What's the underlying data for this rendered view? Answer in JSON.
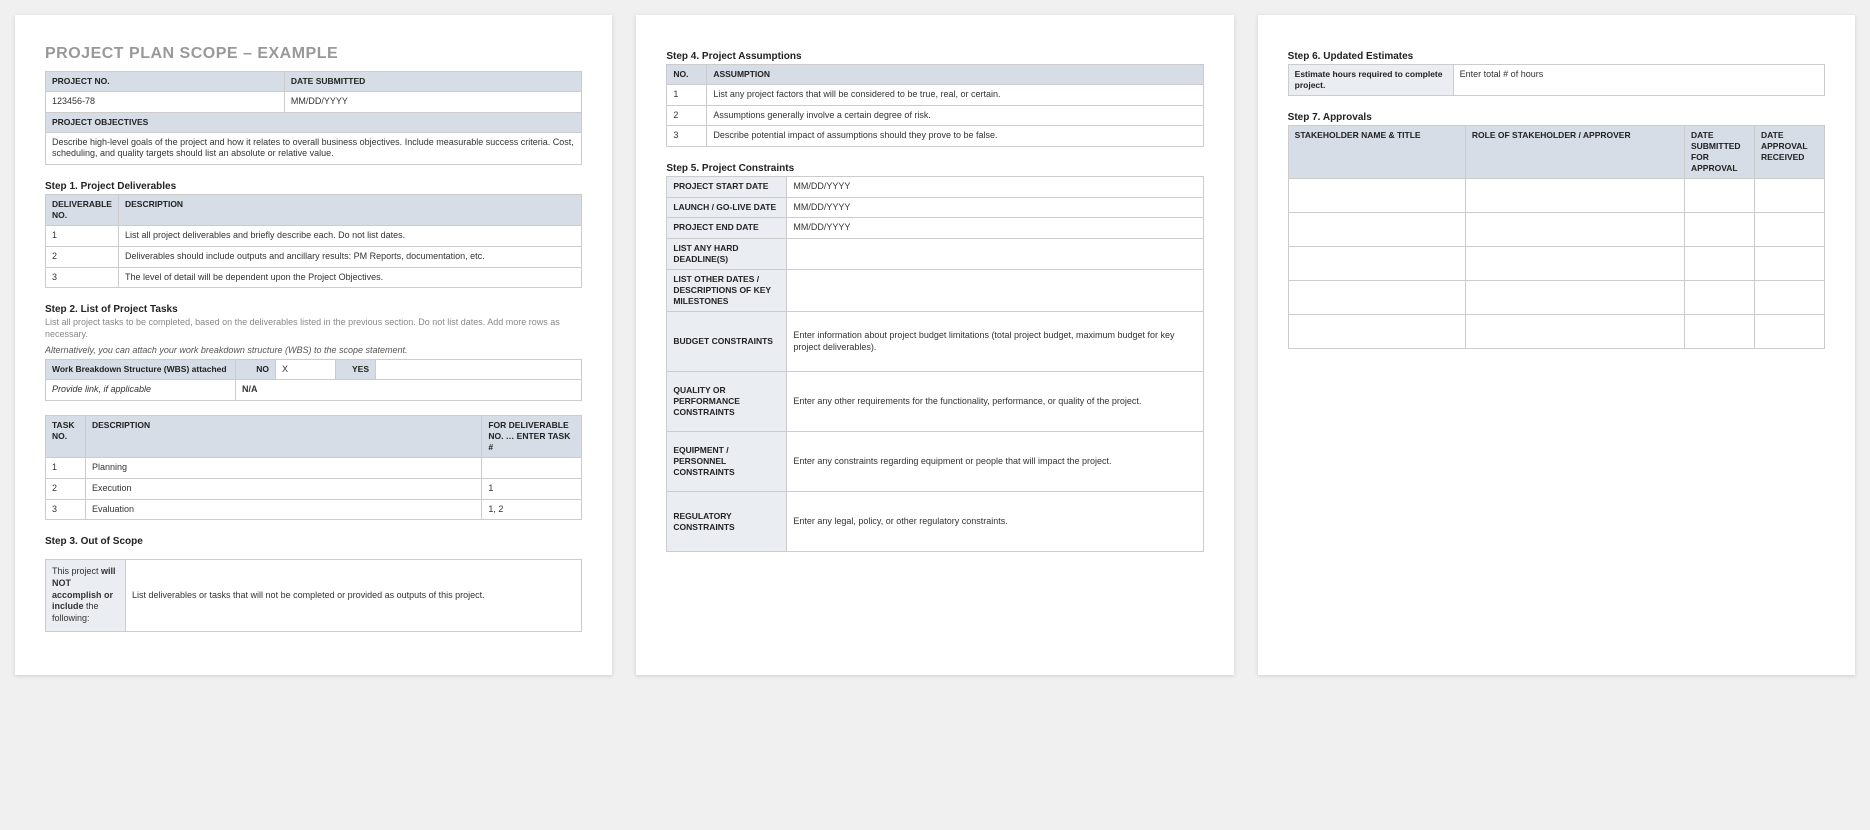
{
  "title": "PROJECT PLAN SCOPE – EXAMPLE",
  "header": {
    "proj_no_label": "PROJECT NO.",
    "proj_no": "123456-78",
    "date_label": "DATE SUBMITTED",
    "date": "MM/DD/YYYY",
    "objectives_label": "PROJECT OBJECTIVES",
    "objectives": "Describe high-level goals of the project and how it relates to overall business objectives.  Include measurable success criteria.  Cost, scheduling, and quality targets should list an absolute or relative value."
  },
  "step1": {
    "title": "Step 1. Project Deliverables",
    "cols": {
      "no": "DELIVERABLE NO.",
      "desc": "DESCRIPTION"
    },
    "rows": [
      {
        "no": "1",
        "desc": "List all project deliverables and briefly describe each. Do not list dates."
      },
      {
        "no": "2",
        "desc": "Deliverables should include outputs and ancillary results: PM Reports, documentation, etc."
      },
      {
        "no": "3",
        "desc": "The level of detail will be dependent upon the Project Objectives."
      }
    ]
  },
  "step2": {
    "title": "Step 2. List of Project Tasks",
    "sub": "List all project tasks to be completed, based on the deliverables listed in the previous section. Do not list dates. Add more rows as necessary.",
    "sub2": "Alternatively, you can attach your work breakdown structure (WBS) to the scope statement.",
    "wbs": {
      "label": "Work Breakdown Structure (WBS) attached",
      "no_label": "NO",
      "no_val": "X",
      "yes_label": "YES",
      "yes_val": "",
      "link_label": "Provide link, if applicable",
      "link_val": "N/A"
    },
    "cols": {
      "no": "TASK NO.",
      "desc": "DESCRIPTION",
      "for": "FOR DELIVERABLE NO. … ENTER TASK #"
    },
    "rows": [
      {
        "no": "1",
        "desc": "Planning",
        "for": ""
      },
      {
        "no": "2",
        "desc": "Execution",
        "for": "1"
      },
      {
        "no": "3",
        "desc": "Evaluation",
        "for": "1, 2"
      }
    ]
  },
  "step3": {
    "title": "Step 3. Out of Scope",
    "left_pre": "This project ",
    "left_bold": "will NOT accomplish or include",
    "left_post": " the following:",
    "right": "List deliverables or tasks that will not be completed or provided as outputs of this project."
  },
  "step4": {
    "title": "Step 4. Project Assumptions",
    "cols": {
      "no": "NO.",
      "a": "ASSUMPTION"
    },
    "rows": [
      {
        "no": "1",
        "a": "List any project factors that will be considered to be true, real, or certain."
      },
      {
        "no": "2",
        "a": "Assumptions generally involve a certain degree of risk."
      },
      {
        "no": "3",
        "a": "Describe potential impact of assumptions should they prove to be false."
      }
    ]
  },
  "step5": {
    "title": "Step 5. Project Constraints",
    "rows": [
      {
        "label": "PROJECT START DATE",
        "val": "MM/DD/YYYY"
      },
      {
        "label": "LAUNCH / GO-LIVE DATE",
        "val": "MM/DD/YYYY"
      },
      {
        "label": "PROJECT END DATE",
        "val": "MM/DD/YYYY"
      },
      {
        "label": "LIST ANY HARD DEADLINE(S)",
        "val": ""
      },
      {
        "label": "LIST OTHER DATES / DESCRIPTIONS OF KEY MILESTONES",
        "val": ""
      },
      {
        "label": "BUDGET CONSTRAINTS",
        "val": "Enter information about project budget limitations (total project budget, maximum budget for key project deliverables)."
      },
      {
        "label": "QUALITY OR PERFORMANCE CONSTRAINTS",
        "val": "Enter any other requirements for the functionality, performance, or quality of the project."
      },
      {
        "label": "EQUIPMENT / PERSONNEL CONSTRAINTS",
        "val": "Enter any constraints regarding equipment or people that will impact the project."
      },
      {
        "label": "REGULATORY CONSTRAINTS",
        "val": "Enter any legal, policy, or other regulatory constraints."
      }
    ]
  },
  "step6": {
    "title": "Step 6. Updated Estimates",
    "label": "Estimate hours required to complete project.",
    "val": "Enter total # of hours"
  },
  "step7": {
    "title": "Step 7. Approvals",
    "cols": {
      "name": "STAKEHOLDER NAME & TITLE",
      "role": "ROLE OF STAKEHOLDER / APPROVER",
      "sub": "DATE SUBMITTED FOR APPROVAL",
      "rec": "DATE APPROVAL RECEIVED"
    }
  }
}
